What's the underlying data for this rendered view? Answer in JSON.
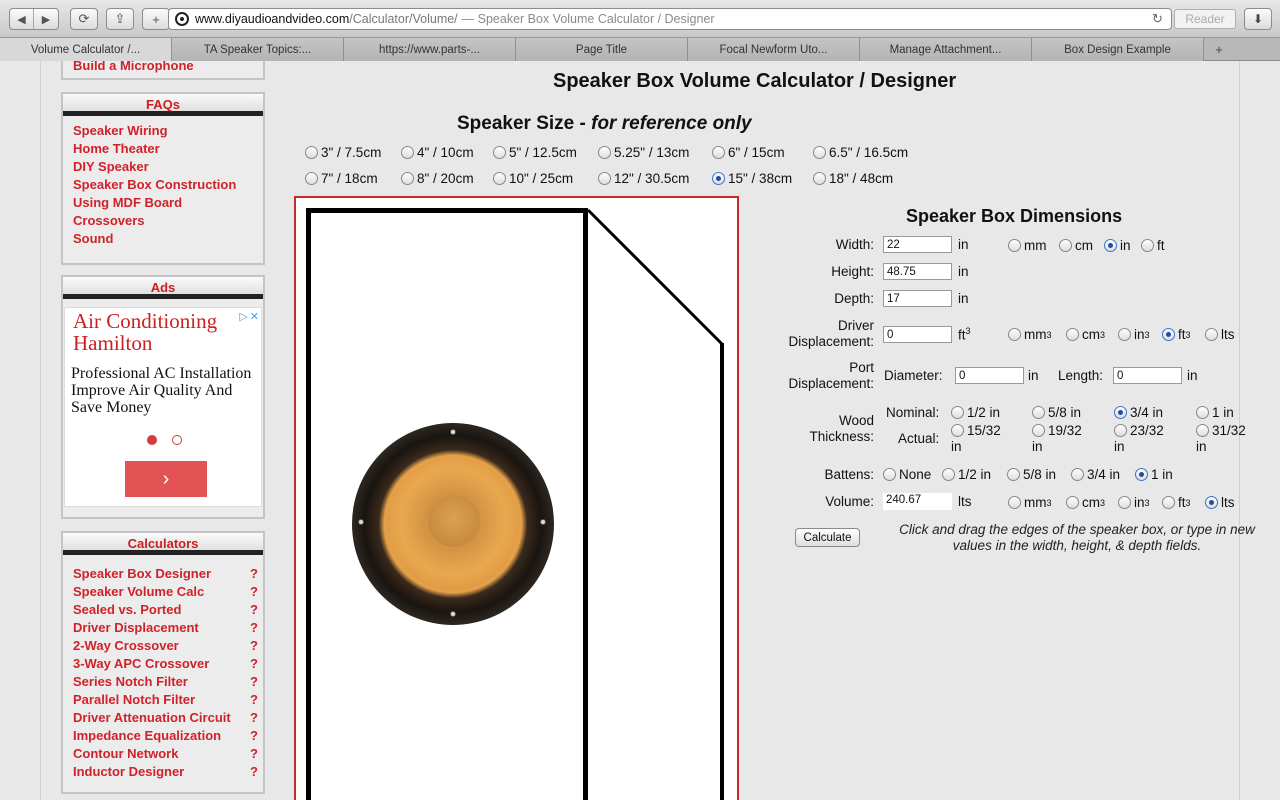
{
  "browser": {
    "url_domain": "www.diyaudioandvideo.com",
    "url_path": "/Calculator/Volume/",
    "url_title": "— Speaker Box Volume Calculator / Designer",
    "reader_label": "Reader",
    "tabs": [
      {
        "label": "Volume Calculator /..."
      },
      {
        "label": "TA Speaker Topics:..."
      },
      {
        "label": "https://www.parts-..."
      },
      {
        "label": "Page Title"
      },
      {
        "label": "Focal Newform Uto..."
      },
      {
        "label": "Manage Attachment..."
      },
      {
        "label": "Box Design Example"
      }
    ],
    "tab_add_label": "+"
  },
  "sidebar": {
    "top_link": "Build a Microphone",
    "faqs": {
      "title": "FAQs",
      "links": [
        "Speaker Wiring",
        "Home Theater",
        "DIY Speaker",
        "Speaker Box Construction",
        "Using MDF Board",
        "Crossovers",
        "Sound"
      ]
    },
    "ads": {
      "title": "Ads",
      "ad_title": "Air Conditioning Hamilton",
      "ad_text": "Professional AC Installation Improve Air Quality And Save Money",
      "next_label": "›"
    },
    "calculators": {
      "title": "Calculators",
      "qmark": "?",
      "links": [
        "Speaker Box Designer",
        "Speaker Volume Calc",
        "Sealed vs. Ported",
        "Driver Displacement",
        "2-Way Crossover",
        "3-Way APC Crossover",
        "Series Notch Filter",
        "Parallel Notch Filter",
        "Driver Attenuation Circuit",
        "Impedance Equalization",
        "Contour Network",
        "Inductor Designer"
      ]
    }
  },
  "main": {
    "title": "Speaker Box Volume Calculator / Designer",
    "size_title": "Speaker Size - ",
    "size_subtitle": "for reference only",
    "sizes": [
      "3\" / 7.5cm",
      "4\" / 10cm",
      "5\" / 12.5cm",
      "5.25\" / 13cm",
      "6\" / 15cm",
      "6.5\" / 16.5cm",
      "7\" / 18cm",
      "8\" / 20cm",
      "10\" / 25cm",
      "12\" / 30.5cm",
      "15\" / 38cm",
      "18\" / 48cm"
    ],
    "selected_size": "15\" / 38cm"
  },
  "dimensions": {
    "title": "Speaker Box Dimensions",
    "width_label": "Width:",
    "width_value": "22",
    "height_label": "Height:",
    "height_value": "48.75",
    "depth_label": "Depth:",
    "depth_value": "17",
    "unit_in": "in",
    "length_units": [
      "mm",
      "cm",
      "in",
      "ft"
    ],
    "selected_length_unit": "in",
    "driver_label_1": "Driver",
    "driver_label_2": "Displacement:",
    "driver_value": "0",
    "driver_unit": "ft",
    "volume_units": [
      "mm",
      "cm",
      "in",
      "ft",
      "lts"
    ],
    "selected_driver_unit": "ft",
    "port_label_1": "Port",
    "port_label_2": "Displacement:",
    "port_diameter_label": "Diameter:",
    "port_diameter_value": "0",
    "port_length_label": "Length:",
    "port_length_value": "0",
    "wood_label_1": "Wood",
    "wood_label_2": "Thickness:",
    "nominal_label": "Nominal:",
    "actual_label": "Actual:",
    "nominal_options": [
      "1/2 in",
      "5/8 in",
      "3/4 in",
      "1 in"
    ],
    "actual_options": [
      "15/32",
      "19/32",
      "23/32",
      "31/32"
    ],
    "selected_nominal": "3/4 in",
    "battens_label": "Battens:",
    "battens_options": [
      "None",
      "1/2 in",
      "5/8 in",
      "3/4 in",
      "1 in"
    ],
    "selected_batten": "1 in",
    "volume_label": "Volume:",
    "volume_value": "240.67",
    "volume_unit": "lts",
    "selected_volume_unit": "lts",
    "calculate_label": "Calculate",
    "hint_text": "Click and drag the edges of the speaker box, or type in new values in the width, height, & depth fields."
  }
}
